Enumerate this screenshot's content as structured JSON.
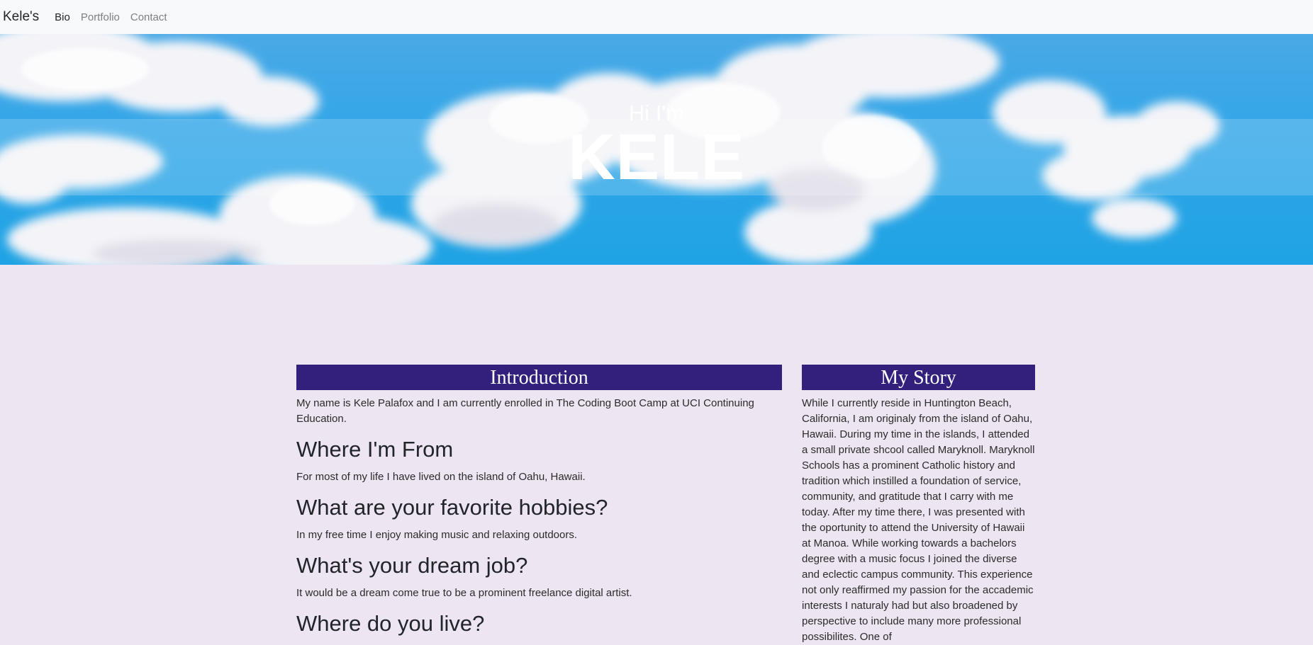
{
  "nav": {
    "brand": "Kele's",
    "items": [
      "Bio",
      "Portfolio",
      "Contact"
    ]
  },
  "hero": {
    "greeting": "Hi I'm",
    "name": "KELE"
  },
  "intro": {
    "title": "Introduction",
    "text": "My name is Kele Palafox and I am currently enrolled in The Coding Boot Camp at UCI Continuing Education.",
    "sections": [
      {
        "heading": "Where I'm From",
        "text": "For most of my life I have lived on the island of Oahu, Hawaii."
      },
      {
        "heading": "What are your favorite hobbies?",
        "text": "In my free time I enjoy making music and relaxing outdoors."
      },
      {
        "heading": "What's your dream job?",
        "text": "It would be a dream come true to be a prominent freelance digital artist."
      },
      {
        "heading": "Where do you live?",
        "text": ""
      }
    ]
  },
  "story": {
    "title": "My Story",
    "text": "While I currently reside in Huntington Beach, California, I am originaly from the island of Oahu, Hawaii. During my time in the islands, I attended a small private shcool called Maryknoll. Maryknoll Schools has a prominent Catholic history and tradition which instilled a foundation of service, community, and gratitude that I carry with me today. After my time there, I was presented with the oportunity to attend the University of Hawaii at Manoa. While working towards a bachelors degree with a music focus I joined the diverse and eclectic campus community. This experience not only reaffirmed my passion for the accademic interests I naturaly had but also broadened by perspective to include many more professional possibilites. One of"
  }
}
